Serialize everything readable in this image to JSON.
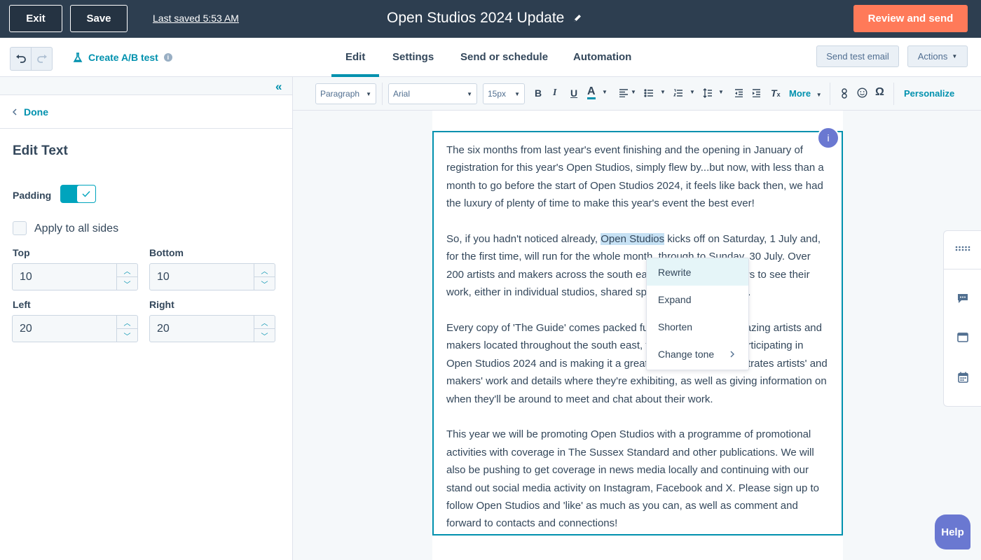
{
  "topbar": {
    "exit_label": "Exit",
    "save_label": "Save",
    "last_saved": "Last saved 5:53 AM",
    "title": "Open Studios 2024 Update",
    "review_label": "Review and send"
  },
  "secondbar": {
    "ab_test_label": "Create A/B test",
    "tabs": [
      {
        "label": "Edit",
        "active": true
      },
      {
        "label": "Settings",
        "active": false
      },
      {
        "label": "Send or schedule",
        "active": false
      },
      {
        "label": "Automation",
        "active": false
      }
    ],
    "send_test_label": "Send test email",
    "actions_label": "Actions"
  },
  "leftpanel": {
    "done_label": "Done",
    "title": "Edit Text",
    "padding_label": "Padding",
    "padding_enabled": true,
    "apply_all_label": "Apply to all sides",
    "apply_all_checked": false,
    "fields": {
      "top": {
        "label": "Top",
        "value": "10"
      },
      "bottom": {
        "label": "Bottom",
        "value": "10"
      },
      "left": {
        "label": "Left",
        "value": "20"
      },
      "right": {
        "label": "Right",
        "value": "20"
      }
    }
  },
  "toolbar": {
    "block_style": "Paragraph",
    "font": "Arial",
    "font_size": "15px",
    "more_label": "More",
    "personalize_label": "Personalize"
  },
  "content": {
    "p1": "The six months from last year's event finishing and the opening in January of registration for this year's Open Studios, simply flew by...but now, with less than a month to go before the start of Open Studios 2024, it feels like back then, we had the luxury of plenty of time to make this year's event the best ever!",
    "p2_before": "So, if you hadn't noticed already, ",
    "p2_highlight": "Open Studios",
    "p2_after": " kicks off on Saturday, 1 July and, for the first time, will run for the whole month, through to Sunday, 30 July. Over 200 artists and makers across the south east, will open their doors to see their work, either in individual studios, shared spaces or group venues.",
    "p3": "Every copy of 'The Guide' comes packed full of the very best amazing artists and makers located throughout the south east, featuring everyone participating in Open Studios 2024 and is making it a great read. The Guide illustrates artists' and makers' work and details where they're exhibiting, as well as giving information on when they'll be around to meet and chat about their work.",
    "p4": "This year we will be promoting Open Studios with a programme of promotional activities with coverage in The Sussex Standard and other publications. We will also be pushing to get coverage in news media locally and continuing with our stand out social media activity on Instagram, Facebook and X. Please sign up to follow Open Studios and 'like' as much as you can, as well as comment and forward to contacts and connections!"
  },
  "context_menu": {
    "items": [
      {
        "label": "Rewrite",
        "active": true
      },
      {
        "label": "Expand",
        "active": false
      },
      {
        "label": "Shorten",
        "active": false
      },
      {
        "label": "Change tone",
        "active": false,
        "submenu": true
      }
    ]
  },
  "help_label": "Help",
  "colors": {
    "topbar_bg": "#2d3e50",
    "accent_orange": "#ff7a59",
    "accent_teal": "#0091ae",
    "toggle_on": "#00a4bd",
    "help_purple": "#6a78d1",
    "selection_highlight": "#c6e1f4"
  },
  "icons": [
    "pencil-icon",
    "undo-icon",
    "redo-icon",
    "flask-icon",
    "info-icon",
    "double-chevron-left-icon",
    "chevron-left-icon",
    "check-icon",
    "chevron-up-icon",
    "chevron-down-icon",
    "bold-icon",
    "italic-icon",
    "underline-icon",
    "text-color-icon",
    "align-icon",
    "bullet-list-icon",
    "numbered-list-icon",
    "line-height-icon",
    "outdent-icon",
    "indent-icon",
    "clear-format-icon",
    "link-icon",
    "emoji-icon",
    "omega-icon",
    "grid-dots-icon",
    "chat-icon",
    "browser-icon",
    "calendar-icon",
    "chevron-right-icon"
  ]
}
